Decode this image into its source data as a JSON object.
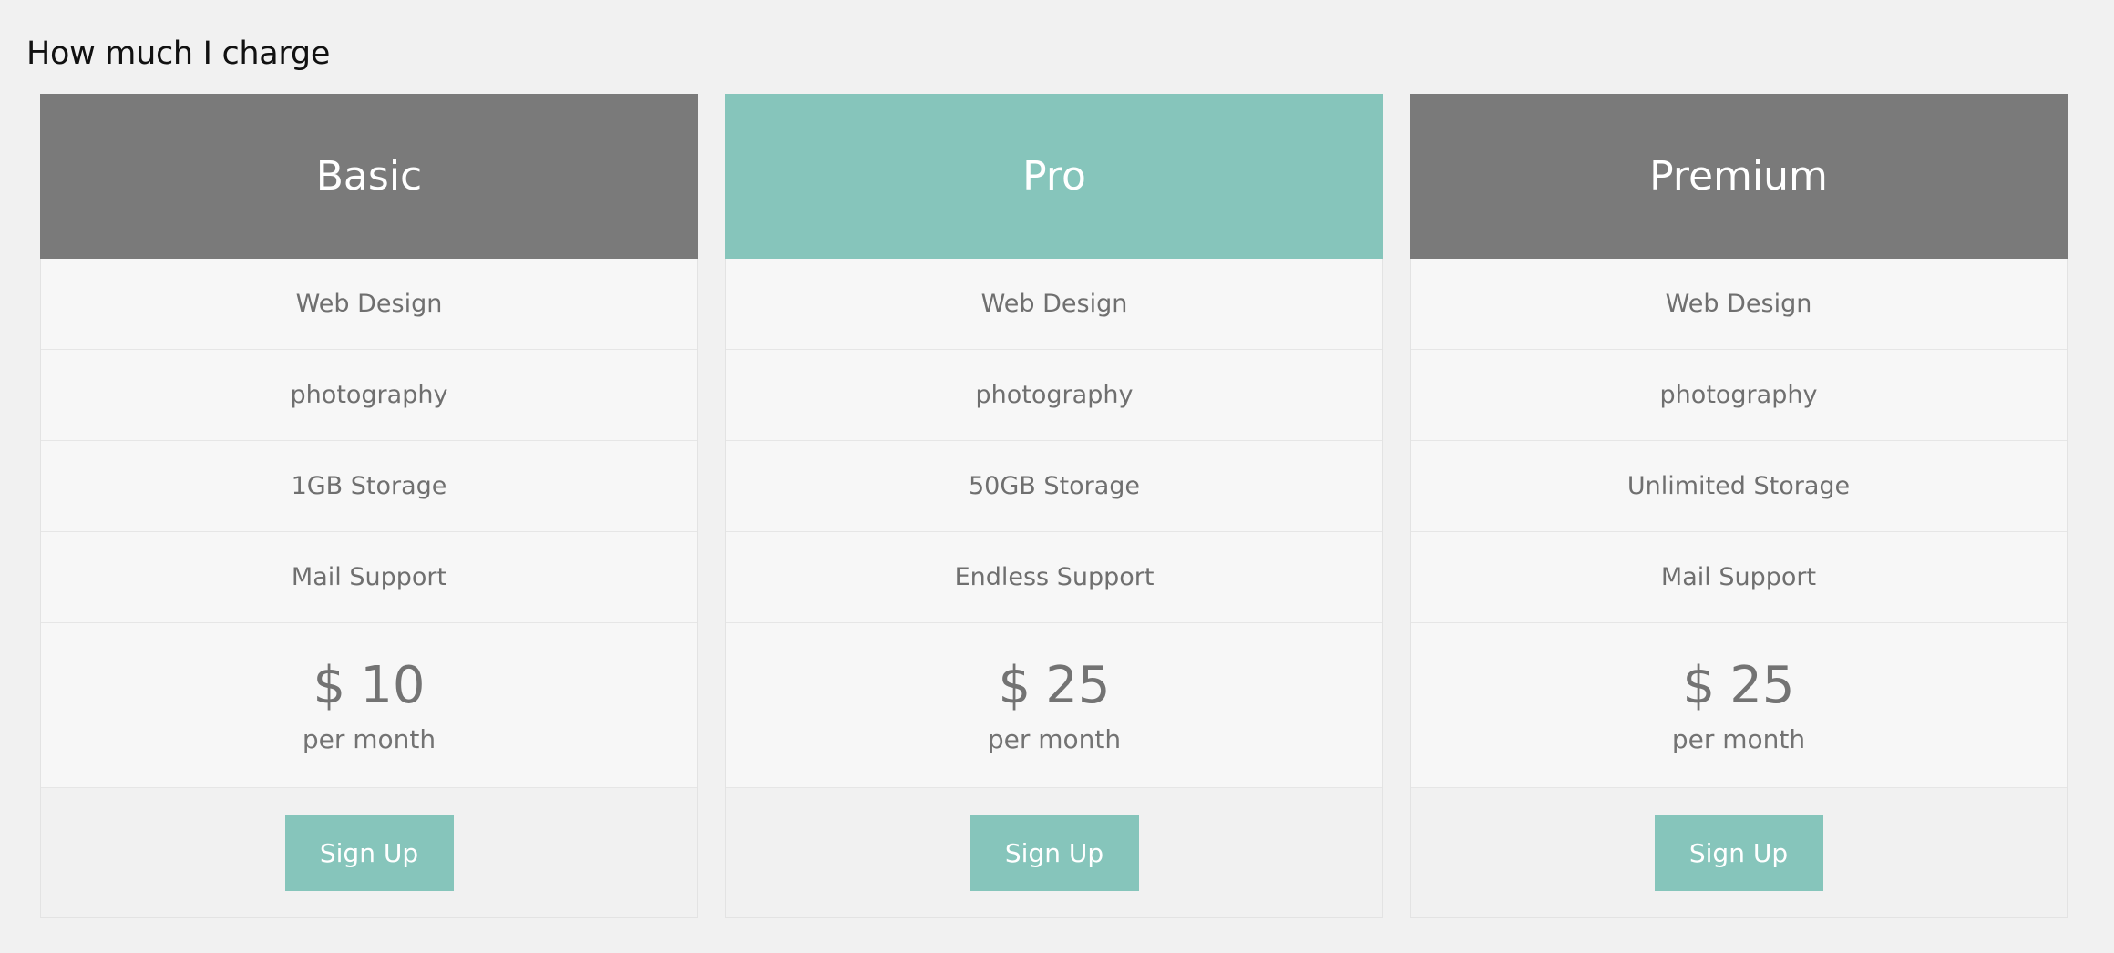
{
  "page": {
    "title": "How much I charge"
  },
  "colors": {
    "background": "#f1f1f1",
    "header_default": "#7a7a7a",
    "header_featured": "#86c5bb",
    "button": "#86c5bb",
    "text_muted": "#6f6f6f"
  },
  "plans": [
    {
      "name": "Basic",
      "featured": false,
      "features": [
        "Web Design",
        "photography",
        "1GB Storage",
        "Mail Support"
      ],
      "currency": "$",
      "price": "10",
      "period": "per month",
      "button_label": "Sign Up"
    },
    {
      "name": "Pro",
      "featured": true,
      "features": [
        "Web Design",
        "photography",
        "50GB Storage",
        "Endless Support"
      ],
      "currency": "$",
      "price": "25",
      "period": "per month",
      "button_label": "Sign Up"
    },
    {
      "name": "Premium",
      "featured": false,
      "features": [
        "Web Design",
        "photography",
        "Unlimited Storage",
        "Mail Support"
      ],
      "currency": "$",
      "price": "25",
      "period": "per month",
      "button_label": "Sign Up"
    }
  ]
}
